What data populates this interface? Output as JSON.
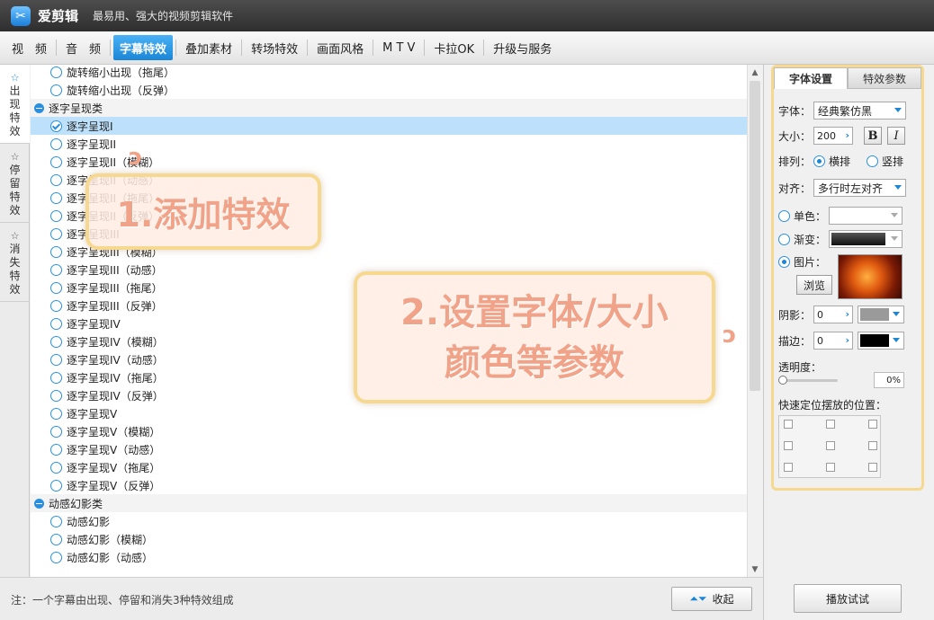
{
  "app": {
    "logo_icon": "scissors-logo-icon",
    "name": "爱剪辑",
    "slogan": "最易用、强大的视频剪辑软件"
  },
  "menu": {
    "tabs": [
      {
        "label": "视　频",
        "active": false
      },
      {
        "label": "音　频",
        "active": false
      },
      {
        "label": "字幕特效",
        "active": true
      },
      {
        "label": "叠加素材",
        "active": false
      },
      {
        "label": "转场特效",
        "active": false
      },
      {
        "label": "画面风格",
        "active": false
      },
      {
        "label": "M T V",
        "active": false
      },
      {
        "label": "卡拉OK",
        "active": false
      },
      {
        "label": "升级与服务",
        "active": false
      }
    ]
  },
  "side_tabs": [
    {
      "label": "出现特效",
      "icon": "appear-star-icon",
      "active": true
    },
    {
      "label": "停留特效",
      "icon": "stay-star-icon",
      "active": false
    },
    {
      "label": "消失特效",
      "icon": "disappear-star-icon",
      "active": false
    }
  ],
  "effects_list": {
    "rows": [
      {
        "type": "item",
        "label": "旋转缩小出现（拖尾）"
      },
      {
        "type": "item",
        "label": "旋转缩小出现（反弹）"
      },
      {
        "type": "category",
        "label": "逐字呈现类"
      },
      {
        "type": "item",
        "label": "逐字呈现I",
        "selected": true
      },
      {
        "type": "item",
        "label": "逐字呈现II"
      },
      {
        "type": "item",
        "label": "逐字呈现II（模糊）"
      },
      {
        "type": "item",
        "label": "逐字呈现II（动感）"
      },
      {
        "type": "item",
        "label": "逐字呈现II（拖尾）"
      },
      {
        "type": "item",
        "label": "逐字呈现II（反弹）"
      },
      {
        "type": "item",
        "label": "逐字呈现III"
      },
      {
        "type": "item",
        "label": "逐字呈现III（模糊）"
      },
      {
        "type": "item",
        "label": "逐字呈现III（动感）"
      },
      {
        "type": "item",
        "label": "逐字呈现III（拖尾）"
      },
      {
        "type": "item",
        "label": "逐字呈现III（反弹）"
      },
      {
        "type": "item",
        "label": "逐字呈现IV"
      },
      {
        "type": "item",
        "label": "逐字呈现IV（模糊）"
      },
      {
        "type": "item",
        "label": "逐字呈现IV（动感）"
      },
      {
        "type": "item",
        "label": "逐字呈现IV（拖尾）"
      },
      {
        "type": "item",
        "label": "逐字呈现IV（反弹）"
      },
      {
        "type": "item",
        "label": "逐字呈现V"
      },
      {
        "type": "item",
        "label": "逐字呈现V（模糊）"
      },
      {
        "type": "item",
        "label": "逐字呈现V（动感）"
      },
      {
        "type": "item",
        "label": "逐字呈现V（拖尾）"
      },
      {
        "type": "item",
        "label": "逐字呈现V（反弹）"
      },
      {
        "type": "category",
        "label": "动感幻影类"
      },
      {
        "type": "item",
        "label": "动感幻影"
      },
      {
        "type": "item",
        "label": "动感幻影（模糊）"
      },
      {
        "type": "item",
        "label": "动感幻影（动感）"
      }
    ]
  },
  "status": {
    "note": "注：一个字幕由出现、停留和消失3种特效组成",
    "collapse_label": "收起",
    "collapse_icon": "collapse-arrows-icon"
  },
  "font_panel": {
    "tabs": [
      {
        "label": "字体设置",
        "active": true
      },
      {
        "label": "特效参数",
        "active": false
      }
    ],
    "font_label": "字体：",
    "font_value": "经典繁仿黑",
    "size_label": "大小：",
    "size_value": "200",
    "bold_label": "B",
    "italic_label": "I",
    "arrange_label": "排列：",
    "arrange_horizontal": "横排",
    "arrange_vertical": "竖排",
    "arrange_selected": "horizontal",
    "align_label": "对齐：",
    "align_value": "多行时左对齐",
    "solid_label": "单色：",
    "gradient_label": "渐变：",
    "image_label": "图片：",
    "fill_selected": "image",
    "browse_label": "浏览",
    "shadow_label": "阴影：",
    "shadow_value": "0",
    "shadow_color": "#9a9a9a",
    "stroke_label": "描边：",
    "stroke_value": "0",
    "stroke_color": "#000000",
    "opacity_label": "透明度：",
    "opacity_value": "0%",
    "position_label": "快速定位摆放的位置：",
    "preview_label": "播放试试"
  },
  "annotations": {
    "step1": "1.添加特效",
    "step2_line1": "2.设置字体/大小",
    "step2_line2": "颜色等参数"
  }
}
